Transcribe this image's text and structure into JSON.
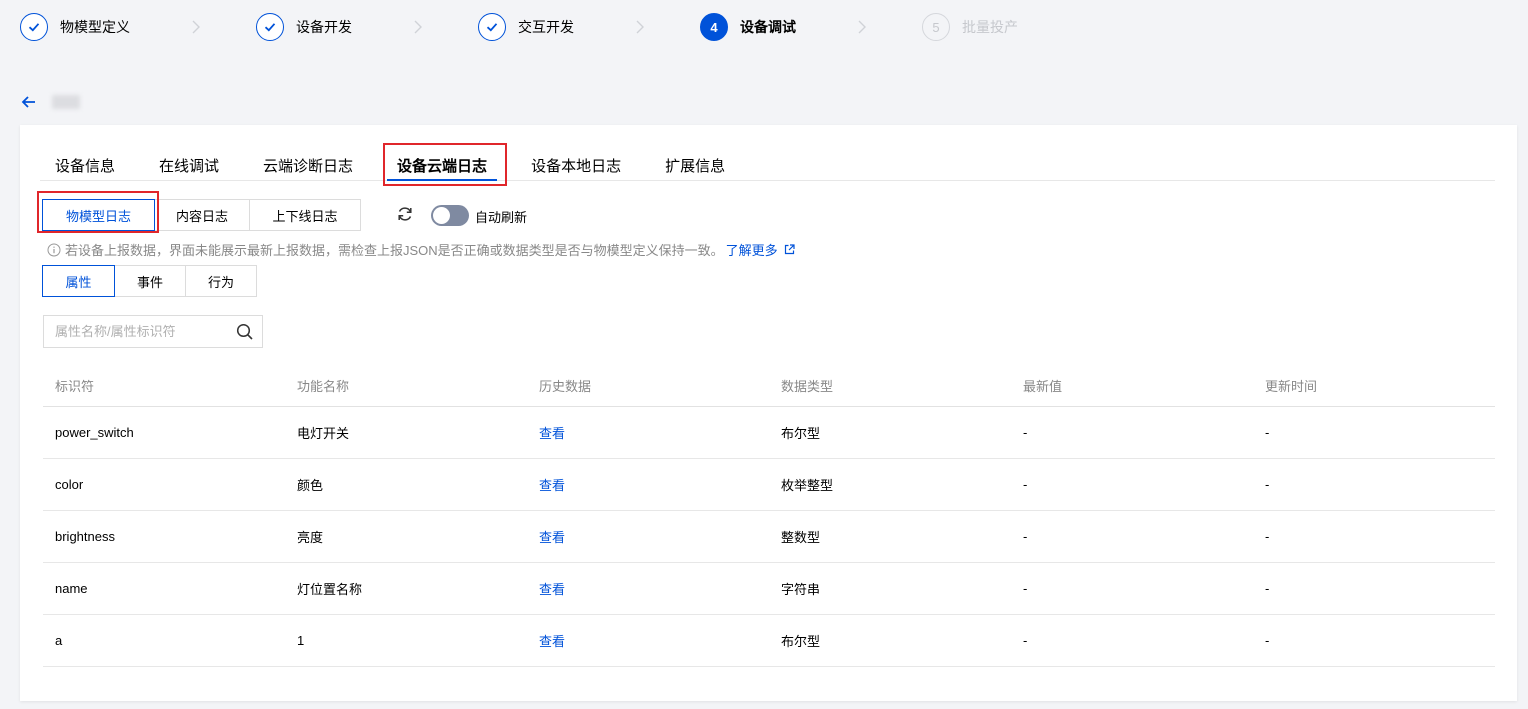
{
  "steps": [
    {
      "label": "物模型定义",
      "state": "done"
    },
    {
      "label": "设备开发",
      "state": "done"
    },
    {
      "label": "交互开发",
      "state": "done"
    },
    {
      "label": "设备调试",
      "state": "current",
      "number": "4"
    },
    {
      "label": "批量投产",
      "state": "todo",
      "number": "5"
    }
  ],
  "tabs": [
    "设备信息",
    "在线调试",
    "云端诊断日志",
    "设备云端日志",
    "设备本地日志",
    "扩展信息"
  ],
  "active_tab": "设备云端日志",
  "log_types": [
    "物模型日志",
    "内容日志",
    "上下线日志"
  ],
  "auto_refresh": {
    "label": "自动刷新",
    "enabled": false
  },
  "tip": {
    "text": "若设备上报数据，界面未能展示最新上报数据，需检查上报JSON是否正确或数据类型是否与物模型定义保持一致。",
    "link": "了解更多"
  },
  "sub_tabs": [
    "属性",
    "事件",
    "行为"
  ],
  "search": {
    "placeholder": "属性名称/属性标识符"
  },
  "table": {
    "headers": [
      "标识符",
      "功能名称",
      "历史数据",
      "数据类型",
      "最新值",
      "更新时间"
    ],
    "rows": [
      [
        "power_switch",
        "电灯开关",
        "查看",
        "布尔型",
        "-",
        "-"
      ],
      [
        "color",
        "颜色",
        "查看",
        "枚举整型",
        "-",
        "-"
      ],
      [
        "brightness",
        "亮度",
        "查看",
        "整数型",
        "-",
        "-"
      ],
      [
        "name",
        "灯位置名称",
        "查看",
        "字符串",
        "-",
        "-"
      ],
      [
        "a",
        "1",
        "查看",
        "布尔型",
        "-",
        "-"
      ]
    ]
  },
  "colors": {
    "primary": "#0052d9",
    "highlight_box": "#e0262b",
    "toggle_off": "#7f8aa1"
  }
}
